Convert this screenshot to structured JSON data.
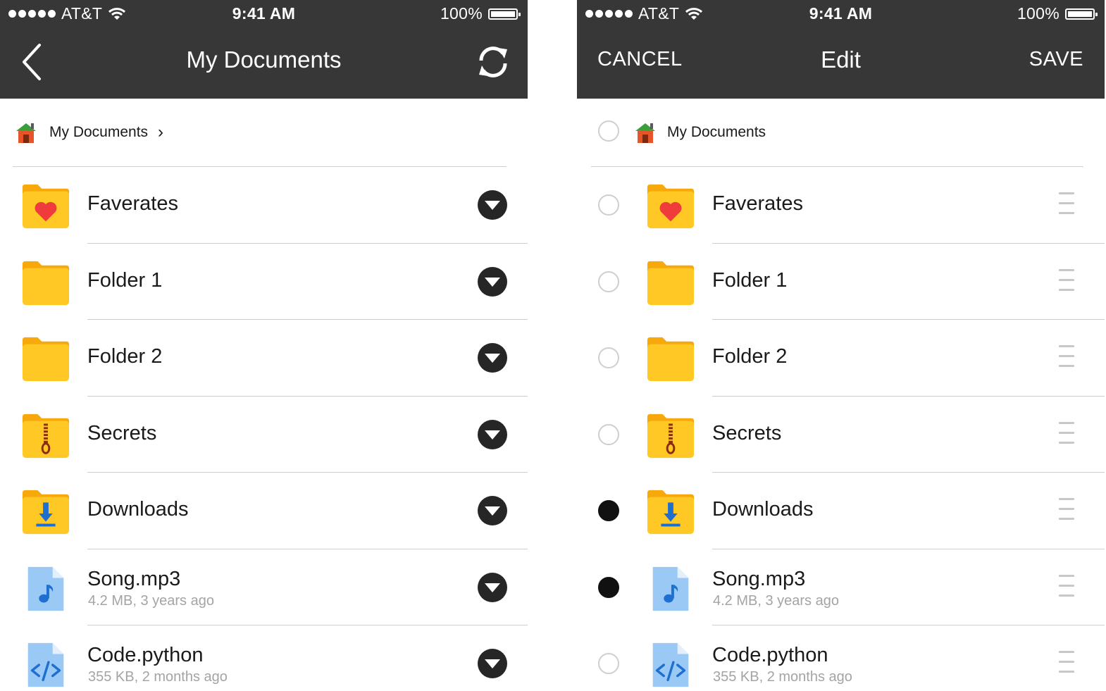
{
  "status_bar": {
    "carrier": "AT&T",
    "time": "9:41 AM",
    "battery": "100%"
  },
  "left": {
    "title": "My Documents",
    "breadcrumb": "My Documents",
    "items": [
      {
        "name": "Faverates",
        "meta": "",
        "icon": "heart-folder-icon"
      },
      {
        "name": "Folder 1",
        "meta": "",
        "icon": "folder-icon"
      },
      {
        "name": "Folder 2",
        "meta": "",
        "icon": "folder-icon"
      },
      {
        "name": "Secrets",
        "meta": "",
        "icon": "zip-folder-icon"
      },
      {
        "name": "Downloads",
        "meta": "",
        "icon": "download-folder-icon"
      },
      {
        "name": "Song.mp3",
        "meta": "4.2 MB, 3 years ago",
        "icon": "music-file-icon"
      },
      {
        "name": "Code.python",
        "meta": "355 KB, 2 months ago",
        "icon": "code-file-icon"
      }
    ]
  },
  "right": {
    "title": "Edit",
    "cancel_label": "CANCEL",
    "save_label": "SAVE",
    "breadcrumb": "My Documents",
    "breadcrumb_selected": false,
    "items": [
      {
        "name": "Faverates",
        "meta": "",
        "icon": "heart-folder-icon",
        "selected": false
      },
      {
        "name": "Folder 1",
        "meta": "",
        "icon": "folder-icon",
        "selected": false
      },
      {
        "name": "Folder 2",
        "meta": "",
        "icon": "folder-icon",
        "selected": false
      },
      {
        "name": "Secrets",
        "meta": "",
        "icon": "zip-folder-icon",
        "selected": false
      },
      {
        "name": "Downloads",
        "meta": "",
        "icon": "download-folder-icon",
        "selected": true
      },
      {
        "name": "Song.mp3",
        "meta": "4.2 MB, 3 years ago",
        "icon": "music-file-icon",
        "selected": true
      },
      {
        "name": "Code.python",
        "meta": "355 KB, 2 months ago",
        "icon": "code-file-icon",
        "selected": false
      }
    ]
  },
  "colors": {
    "navbar": "#373737",
    "folder": "#FFC825",
    "folder_tab": "#F7A90C",
    "file": "#99C9F4",
    "file_glyph": "#1E6FCF",
    "heart": "#EF3B3B"
  }
}
